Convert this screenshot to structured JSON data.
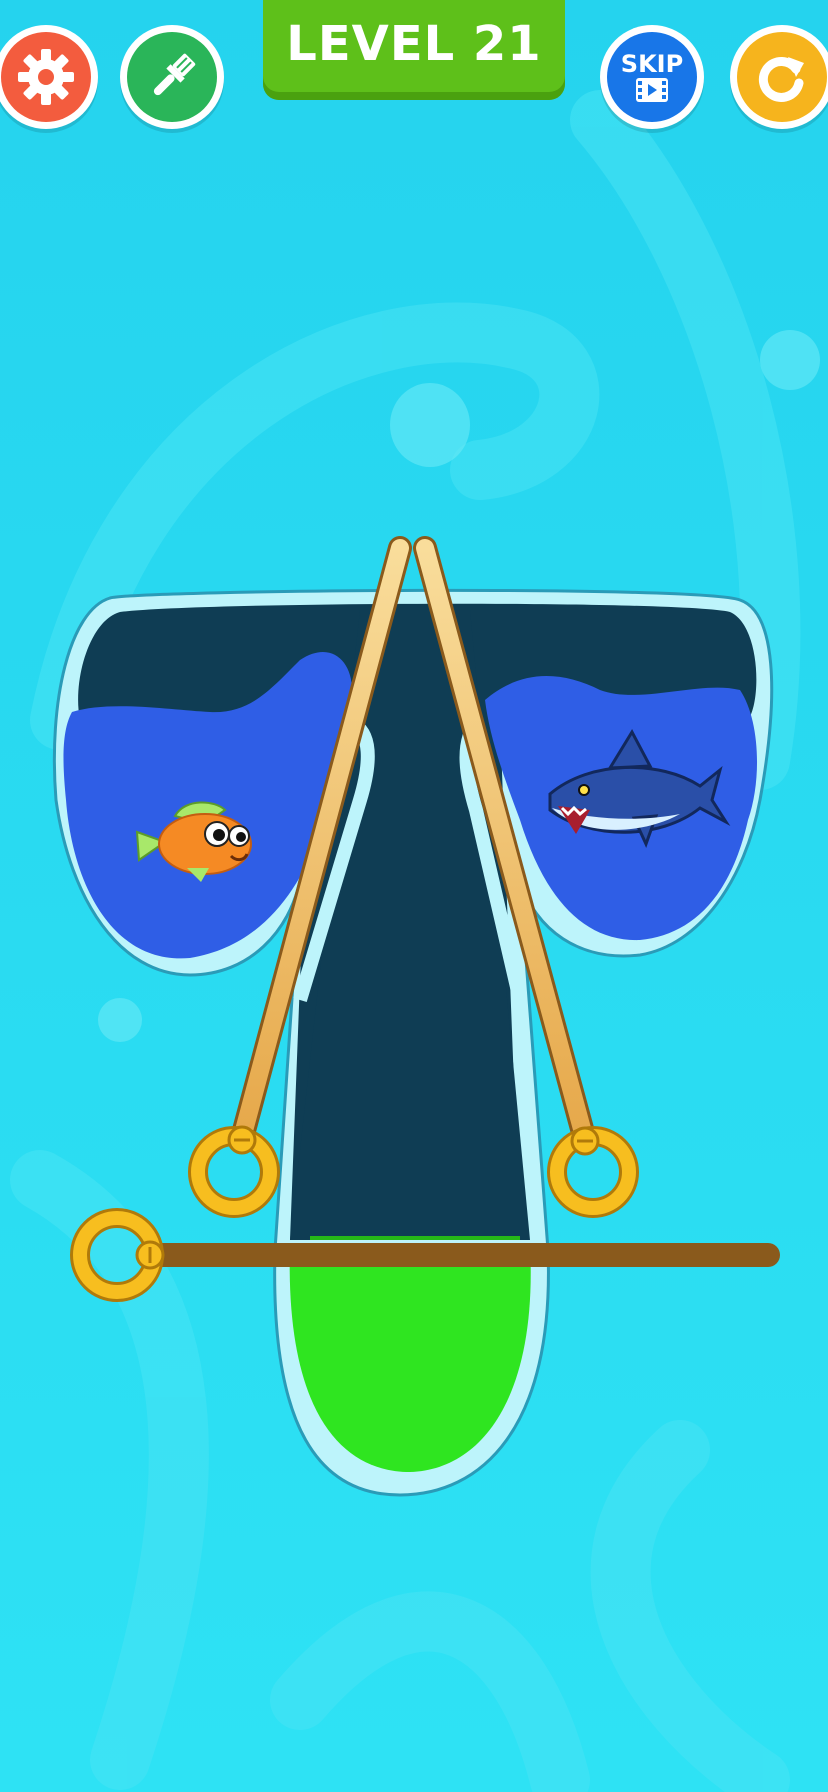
{
  "hud": {
    "level_text": "LEVEL 21",
    "skip_label": "SKIP",
    "icons": {
      "settings": "gear-icon",
      "paint": "paintbrush-icon",
      "skip_video": "video-film-icon",
      "restart": "restart-arrow-icon"
    }
  },
  "colors": {
    "background": "#27d6ee",
    "settings_button": "#f35c3e",
    "paint_button": "#2ab559",
    "level_badge": "#5ec01a",
    "skip_button": "#1876e8",
    "restart_button": "#f6b41d",
    "water": "#2f5ee6",
    "dark_cavity": "#0f3d54",
    "goo": "#2fe520",
    "pin": "#f4c96a",
    "pin_ring": "#f7be1f"
  },
  "puzzle": {
    "left_pocket": "water-with-fish",
    "right_pocket": "water-with-shark",
    "bottom_pocket": "green-goo",
    "pins": [
      "left-diagonal-pin",
      "right-diagonal-pin",
      "horizontal-pin"
    ]
  }
}
